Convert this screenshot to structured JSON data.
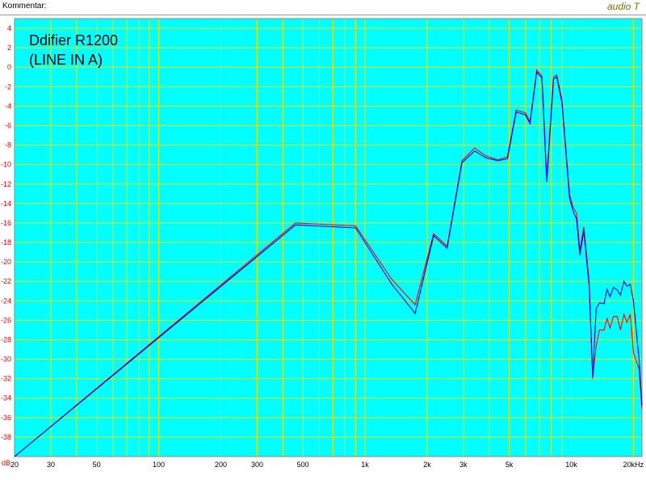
{
  "header": {
    "comment_label": "Kommentar:",
    "brand": "audio T"
  },
  "colors": {
    "background": "#00ffff",
    "grid": "#e6e600",
    "series_red": "#ff0000",
    "series_blue": "#0000ff",
    "tick_red": "#ff0000"
  },
  "chart_data": {
    "type": "line",
    "title": "Ddifier R1200\n(LINE IN A)",
    "title_lines": [
      "Ddifier R1200",
      "(LINE IN A)"
    ],
    "xscale": "log",
    "xlim": [
      20,
      22000
    ],
    "ylim": [
      -40,
      5
    ],
    "grid": true,
    "y_unit": "dB",
    "x_unit": "Hz",
    "y_ticks": [
      4,
      2,
      0,
      -2,
      -4,
      -6,
      -8,
      -10,
      -12,
      -14,
      -16,
      -18,
      -20,
      -22,
      -24,
      -26,
      -28,
      -30,
      -32,
      -34,
      -36,
      -38
    ],
    "x_ticks": [
      {
        "value": 20,
        "label": "20"
      },
      {
        "value": 30,
        "label": "30"
      },
      {
        "value": 50,
        "label": "50"
      },
      {
        "value": 100,
        "label": "100"
      },
      {
        "value": 200,
        "label": "200"
      },
      {
        "value": 300,
        "label": "300"
      },
      {
        "value": 500,
        "label": "500"
      },
      {
        "value": 1000,
        "label": "1k"
      },
      {
        "value": 2000,
        "label": "2k"
      },
      {
        "value": 3000,
        "label": "3k"
      },
      {
        "value": 5000,
        "label": "5k"
      },
      {
        "value": 10000,
        "label": "10k"
      },
      {
        "value": 20000,
        "label": "20kHz"
      }
    ],
    "y_unit_label": "dB",
    "series": [
      {
        "color": "#ff0000",
        "points": [
          [
            20,
            -40
          ],
          [
            460,
            -16.0
          ],
          [
            900,
            -16.3
          ],
          [
            1350,
            -21.8
          ],
          [
            1750,
            -24.4
          ],
          [
            2150,
            -17.1
          ],
          [
            2500,
            -18.4
          ],
          [
            2950,
            -9.6
          ],
          [
            3400,
            -8.3
          ],
          [
            3850,
            -9.1
          ],
          [
            4400,
            -9.5
          ],
          [
            4900,
            -9.2
          ],
          [
            5400,
            -4.4
          ],
          [
            6000,
            -4.7
          ],
          [
            6300,
            -5.6
          ],
          [
            6800,
            -0.3
          ],
          [
            7200,
            -0.9
          ],
          [
            7600,
            -11.3
          ],
          [
            8200,
            -1.0
          ],
          [
            8500,
            -0.8
          ],
          [
            9000,
            -3.3
          ],
          [
            9800,
            -13.0
          ],
          [
            10200,
            -14.4
          ],
          [
            10600,
            -15.0
          ],
          [
            11000,
            -18.8
          ],
          [
            11500,
            -16.4
          ],
          [
            12200,
            -22.0
          ],
          [
            12700,
            -32.0
          ],
          [
            13200,
            -28.6
          ],
          [
            13700,
            -27.0
          ],
          [
            14400,
            -27.0
          ],
          [
            14900,
            -25.8
          ],
          [
            15400,
            -26.8
          ],
          [
            16000,
            -25.6
          ],
          [
            16700,
            -25.6
          ],
          [
            17300,
            -27.0
          ],
          [
            18000,
            -25.4
          ],
          [
            18600,
            -26.2
          ],
          [
            19300,
            -25.4
          ],
          [
            20000,
            -29.3
          ],
          [
            21300,
            -31.0
          ],
          [
            22000,
            -35.1
          ]
        ]
      },
      {
        "color": "#0000ff",
        "points": [
          [
            20,
            -40
          ],
          [
            460,
            -16.2
          ],
          [
            900,
            -16.5
          ],
          [
            1350,
            -22.3
          ],
          [
            1750,
            -25.3
          ],
          [
            2150,
            -17.3
          ],
          [
            2500,
            -18.6
          ],
          [
            2950,
            -9.8
          ],
          [
            3400,
            -8.6
          ],
          [
            3850,
            -9.3
          ],
          [
            4400,
            -9.6
          ],
          [
            4900,
            -9.4
          ],
          [
            5400,
            -4.6
          ],
          [
            6000,
            -4.9
          ],
          [
            6300,
            -5.8
          ],
          [
            6800,
            -0.5
          ],
          [
            7200,
            -1.1
          ],
          [
            7600,
            -11.8
          ],
          [
            8200,
            -1.2
          ],
          [
            8500,
            -1.0
          ],
          [
            9000,
            -3.6
          ],
          [
            9800,
            -13.4
          ],
          [
            10200,
            -14.8
          ],
          [
            10600,
            -15.6
          ],
          [
            11000,
            -19.3
          ],
          [
            11500,
            -16.8
          ],
          [
            12200,
            -22.5
          ],
          [
            12700,
            -31.8
          ],
          [
            13200,
            -24.8
          ],
          [
            13700,
            -24.2
          ],
          [
            14400,
            -24.3
          ],
          [
            14900,
            -22.8
          ],
          [
            15400,
            -23.6
          ],
          [
            16000,
            -22.6
          ],
          [
            16700,
            -22.9
          ],
          [
            17300,
            -23.4
          ],
          [
            18000,
            -22.0
          ],
          [
            18600,
            -22.5
          ],
          [
            19300,
            -22.3
          ],
          [
            20000,
            -24.0
          ],
          [
            21300,
            -30.0
          ],
          [
            22000,
            -34.8
          ]
        ]
      }
    ]
  }
}
